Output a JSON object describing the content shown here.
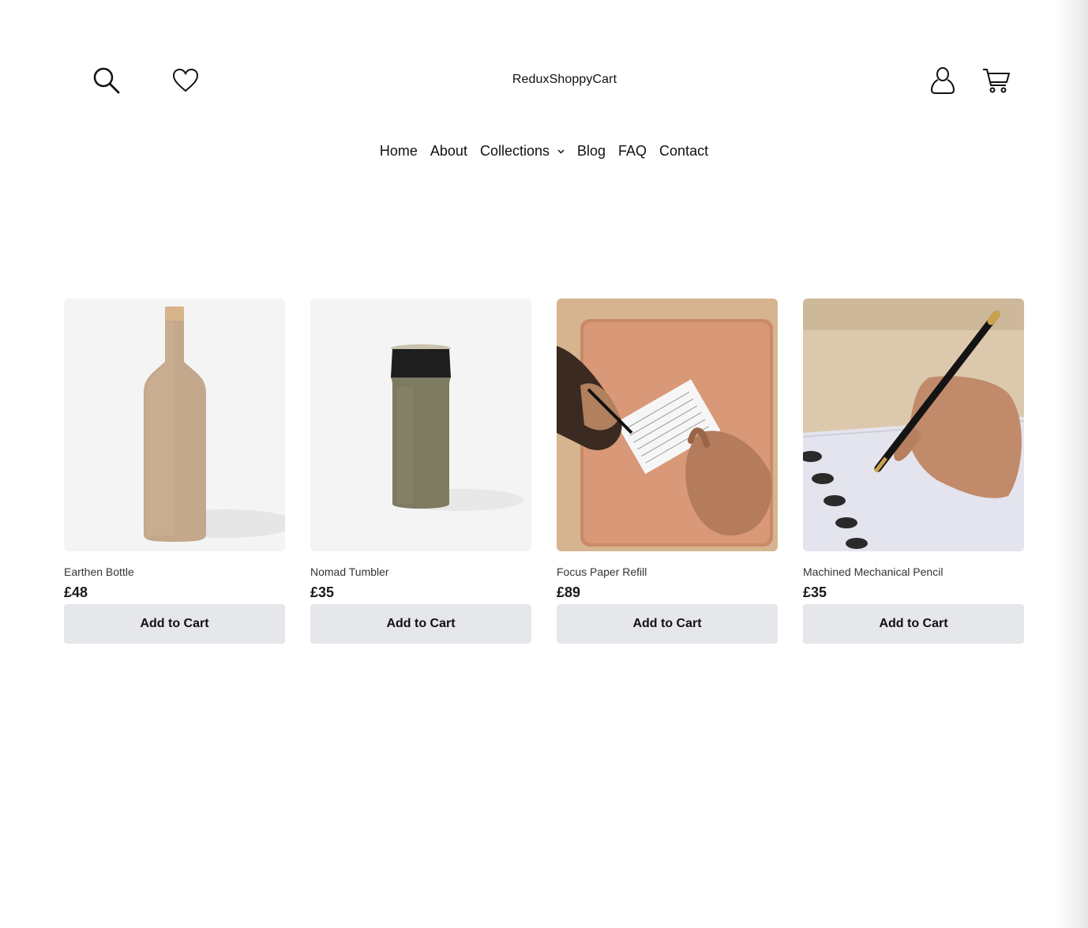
{
  "header": {
    "brand": "ReduxShoppyCart",
    "icons": [
      "search-icon",
      "heart-icon",
      "user-icon",
      "cart-icon"
    ]
  },
  "nav": {
    "items": [
      {
        "label": "Home"
      },
      {
        "label": "About"
      },
      {
        "label": "Collections"
      },
      {
        "label": "Blog"
      },
      {
        "label": "FAQ"
      },
      {
        "label": "Contact"
      }
    ],
    "dropdown_icon": "ˇ"
  },
  "products": [
    {
      "name": "Earthen Bottle",
      "price": "£48",
      "button": "Add to Cart"
    },
    {
      "name": "Nomad Tumbler",
      "price": "£35",
      "button": "Add to Cart"
    },
    {
      "name": "Focus Paper Refill",
      "price": "£89",
      "button": "Add to Cart"
    },
    {
      "name": "Machined Mechanical Pencil",
      "price": "£35",
      "button": "Add to Cart"
    }
  ],
  "colors": {
    "button_bg": "#e5e7eb",
    "text": "#111111"
  }
}
